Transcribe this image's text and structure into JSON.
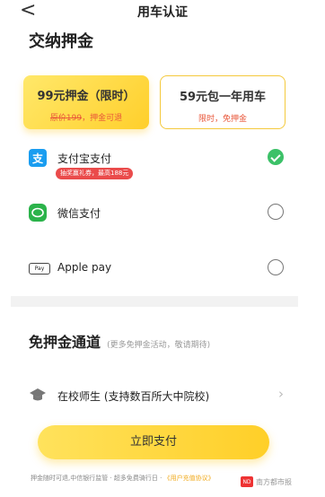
{
  "nav": {
    "back_glyph": "<",
    "title": "用车认证"
  },
  "deposit_section": {
    "title": "交纳押金"
  },
  "plans": [
    {
      "name": "99元押金（限时）",
      "sub_strike": "原价199",
      "sub_tail": "，押金可退",
      "selected": true
    },
    {
      "name": "59元包一年用车",
      "sub": "限时，免押金",
      "selected": false
    }
  ],
  "payments": [
    {
      "icon": "alipay-icon",
      "icon_glyph": "支",
      "label": "支付宝支付",
      "badge": "抽奖赢礼券，最高188元",
      "checked": true
    },
    {
      "icon": "wechat-pay-icon",
      "label": "微信支付",
      "checked": false
    },
    {
      "icon": "apple-pay-icon",
      "icon_glyph": "Pay",
      "label": "Apple pay",
      "checked": false
    }
  ],
  "free_section": {
    "title": "免押金通道",
    "note": "(更多免押金活动，敬请期待)"
  },
  "student": {
    "icon": "graduation-cap-icon",
    "label": "在校师生 (支持数百所大中院校)"
  },
  "pay_button": {
    "label": "立即支付"
  },
  "footer": {
    "text": "押金随时可退,中信银行监管  · 超多免费骑行日  · ",
    "link": "《用户充值协议》"
  },
  "watermark": {
    "logo": "ND",
    "text": "南方都市报"
  },
  "colors": {
    "accent": "#ffd43b",
    "alipay": "#1a9df0",
    "wechat": "#2bb34a",
    "check": "#3cc168",
    "warning": "#e9573a"
  }
}
